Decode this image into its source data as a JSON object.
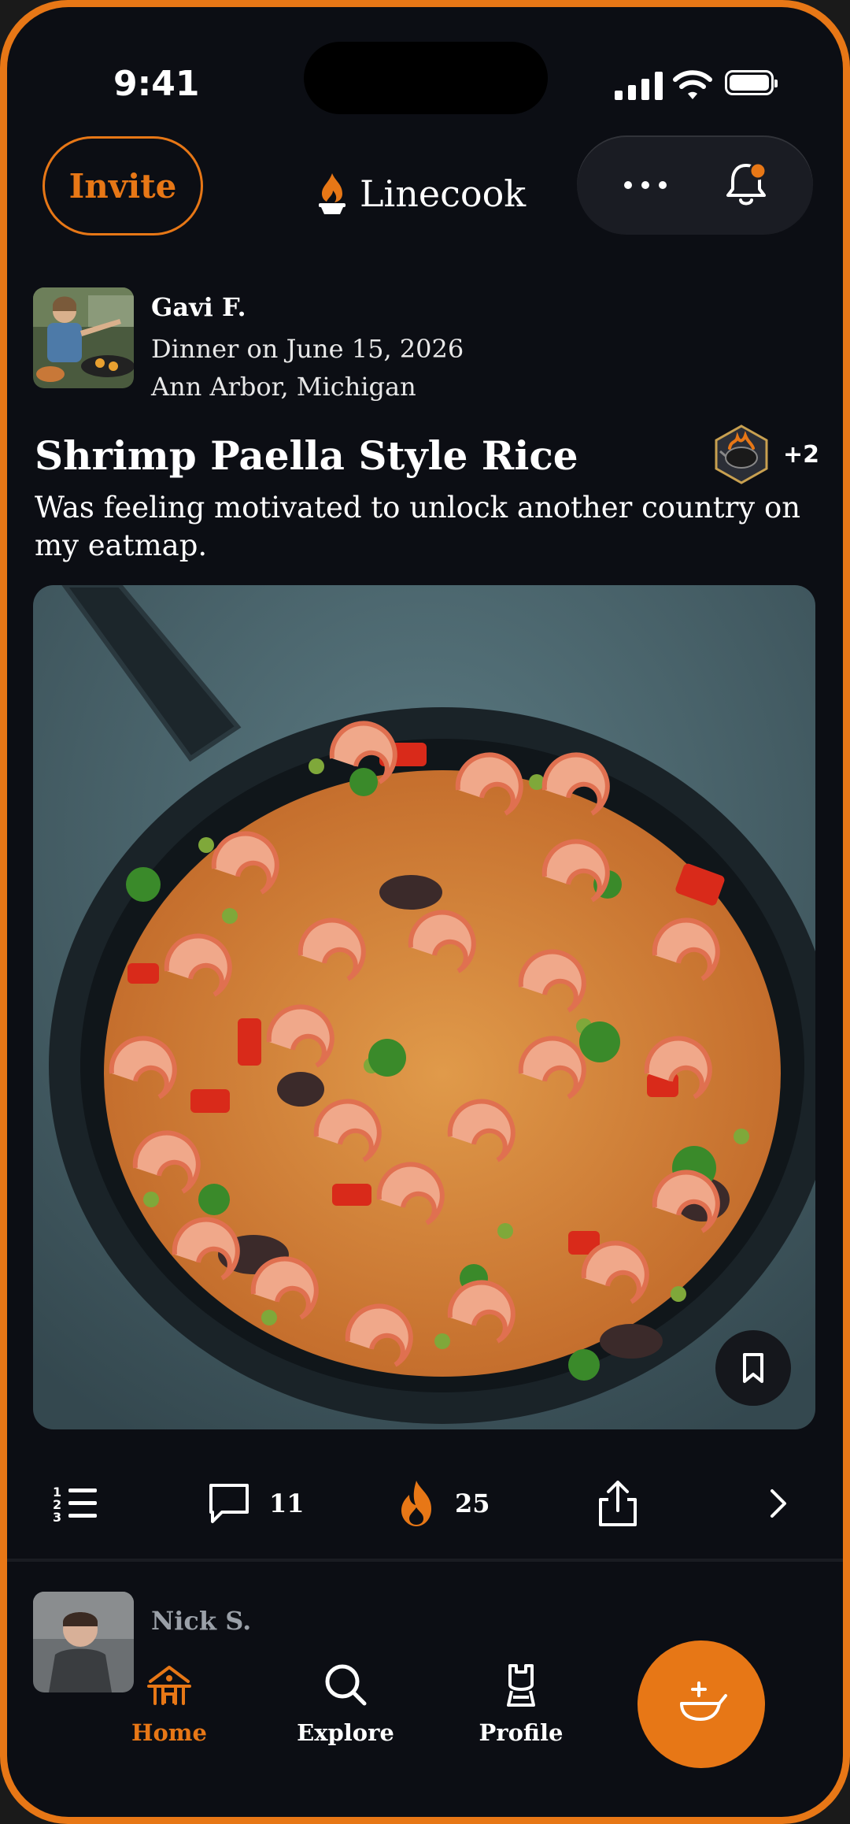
{
  "status_bar": {
    "time": "9:41"
  },
  "header": {
    "invite_label": "Invite",
    "app_name": "Linecook"
  },
  "post": {
    "author": "Gavi F.",
    "meal_line": "Dinner on June 15, 2026",
    "location": "Ann Arbor, Michigan",
    "title": "Shrimp Paella Style Rice",
    "badge_extra": "+2",
    "description": "Was feeling motivated to unlock another country on my eatmap.",
    "comments_count": "11",
    "fire_count": "25"
  },
  "next_post": {
    "author": "Nick S."
  },
  "tab_bar": {
    "home_label": "Home",
    "explore_label": "Explore",
    "profile_label": "Profile"
  },
  "colors": {
    "accent": "#e77716",
    "background": "#0c0e14",
    "text": "#ffffff",
    "muted": "#9aa0a8"
  },
  "icons": {
    "header": [
      "flame-logo-icon",
      "more-dots-icon",
      "bell-icon"
    ],
    "actions": [
      "recipe-list-icon",
      "comment-icon",
      "fire-icon",
      "share-icon",
      "chevron-right-icon"
    ],
    "photo": [
      "bookmark-icon"
    ],
    "tabs": [
      "home-icon",
      "search-icon",
      "chef-hat-icon",
      "add-dish-icon"
    ]
  }
}
